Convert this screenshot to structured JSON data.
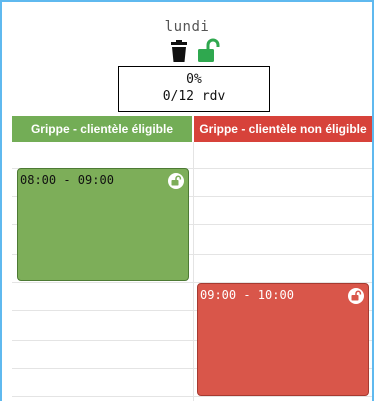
{
  "day": {
    "label": "lundi"
  },
  "stats": {
    "percent": "0%",
    "appointments": "0/12 rdv"
  },
  "columns": [
    {
      "title": "Grippe - clientèle éligible",
      "color": "#73ad56"
    },
    {
      "title": "Grippe - clientèle non éligible",
      "color": "#d7423a"
    }
  ],
  "events": [
    {
      "time": "08:00 - 09:00",
      "column": "Grippe - clientèle éligible",
      "color": "#7dae59"
    },
    {
      "time": "09:00 - 10:00",
      "column": "Grippe - clientèle non éligible",
      "color": "#d9564a"
    }
  ],
  "icons": {
    "delete": "trash-icon",
    "unlock": "unlock-icon",
    "event_lock": "unlock-icon"
  },
  "colors": {
    "frame": "#5fb9ef",
    "unlock_green": "#2fa84f"
  }
}
